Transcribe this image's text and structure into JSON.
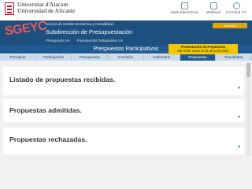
{
  "university": {
    "name_line1": "Universitat d'Alacant",
    "name_line2": "Universidad de Alicante"
  },
  "utility_links": [
    {
      "label": "Sede Electrónica",
      "icon": "building-icon"
    },
    {
      "label": "Webmail",
      "icon": "mail-icon"
    },
    {
      "label": "UACloud CV",
      "icon": "cloud-icon"
    }
  ],
  "header": {
    "logo_text": "SGEYC",
    "service_name": "Servicio de Gestión Económica y Contabilidad",
    "title": "Subdirección de Presupuestación",
    "breadcrumbs": [
      "Presupuesto UA",
      "Presupuestos Participativos UA"
    ],
    "servicios_button": "Servicios"
  },
  "page_title": "Prespuestos Participativos",
  "notice": {
    "title": "Presentación de Propuestas",
    "dates": "del 16 de mayo al 15 de junio 2022"
  },
  "tabs": [
    {
      "label": "Principios"
    },
    {
      "label": "Participación"
    },
    {
      "label": "Presupuesto"
    },
    {
      "label": "Comisión"
    },
    {
      "label": "Calendario"
    },
    {
      "label": "Propuestas"
    },
    {
      "label": "Resultados"
    }
  ],
  "active_tab": "Propuestas",
  "sections": [
    {
      "title": "Listado de propuestas recibidas."
    },
    {
      "title": "Propuestas admitidas."
    },
    {
      "title": "Propuestas rechazadas."
    }
  ],
  "colors": {
    "header_blue": "#1d4f7f",
    "accent_yellow": "#f2c700",
    "brand_red": "#c8102e"
  }
}
